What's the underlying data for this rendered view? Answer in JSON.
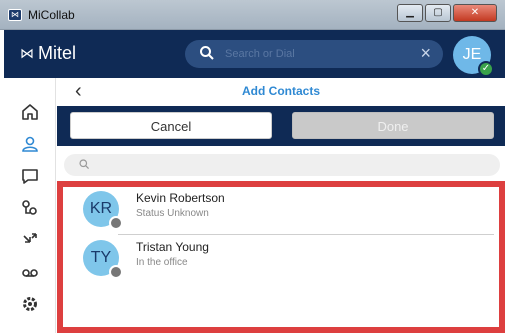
{
  "window": {
    "title": "MiCollab",
    "controls": [
      "minimize",
      "maximize",
      "close"
    ]
  },
  "header": {
    "brand": "Mitel",
    "search": {
      "placeholder": "Search or Dial",
      "value": ""
    },
    "user_avatar": {
      "initials": "JE",
      "presence": "available",
      "presence_color": "#3aa34a"
    }
  },
  "sidebar": {
    "items": [
      {
        "icon": "home-icon"
      },
      {
        "icon": "contacts-icon",
        "active": true
      },
      {
        "icon": "chat-icon"
      },
      {
        "icon": "call-history-icon"
      },
      {
        "icon": "call-forward-icon"
      },
      {
        "icon": "voicemail-icon"
      },
      {
        "icon": "settings-icon"
      }
    ]
  },
  "panel": {
    "title": "Add Contacts",
    "cancel_label": "Cancel",
    "done_label": "Done",
    "filter_placeholder": ""
  },
  "contacts": [
    {
      "initials": "KR",
      "name": "Kevin Robertson",
      "status": "Status Unknown",
      "status_color": "#777777"
    },
    {
      "initials": "TY",
      "name": "Tristan Young",
      "status": "In the office",
      "status_color": "#777777"
    }
  ],
  "colors": {
    "header_bg": "#0f2a55",
    "accent": "#2f89d3",
    "highlight_border": "#dd3f3f"
  }
}
